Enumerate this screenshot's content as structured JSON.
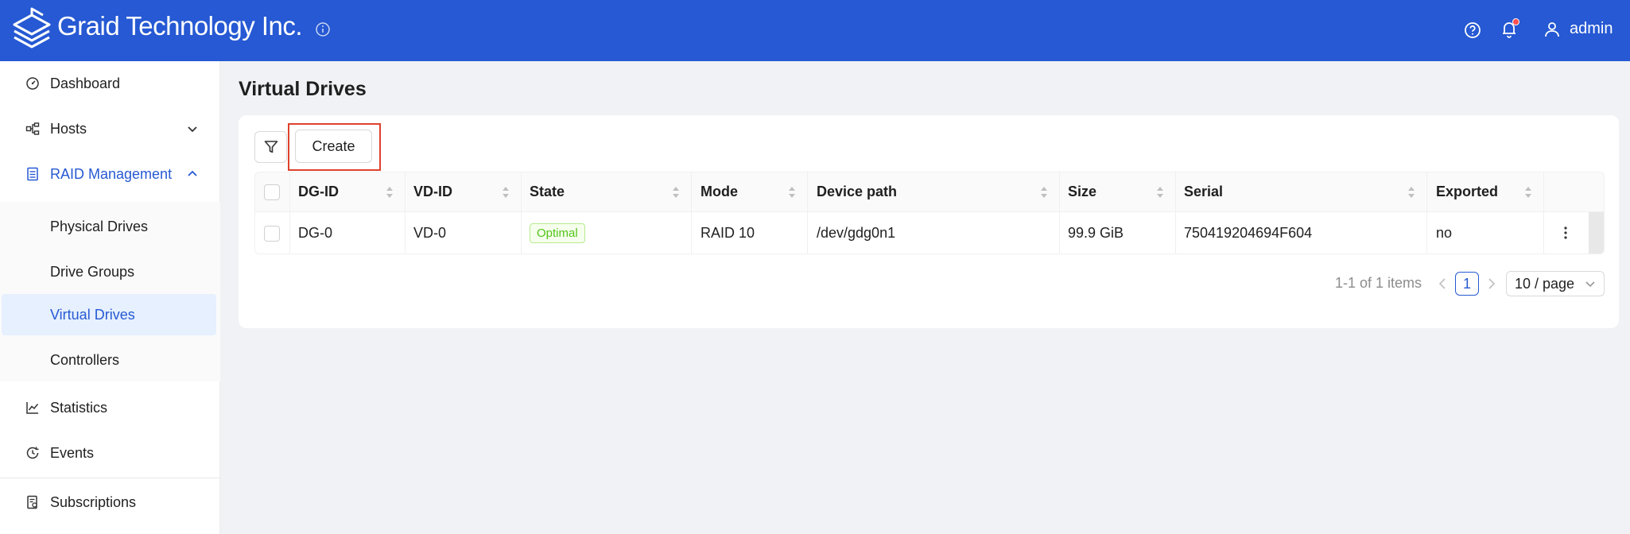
{
  "header": {
    "brand": "Graid Technology Inc.",
    "username": "admin",
    "colors": {
      "bar": "#2659d3",
      "notification_dot": "#ff4d4f"
    },
    "icons": [
      "logo-icon",
      "info-icon",
      "help-icon",
      "bell-icon",
      "user-icon"
    ]
  },
  "sidebar": {
    "items": [
      {
        "label": "Dashboard",
        "icon": "dashboard-icon"
      },
      {
        "label": "Hosts",
        "icon": "hosts-icon",
        "expanded": false
      },
      {
        "label": "RAID Management",
        "icon": "raid-icon",
        "expanded": true
      },
      {
        "label": "Statistics",
        "icon": "statistics-icon"
      },
      {
        "label": "Events",
        "icon": "events-icon"
      },
      {
        "label": "Subscriptions",
        "icon": "subscriptions-icon"
      }
    ],
    "raid_submenu": [
      {
        "label": "Physical Drives"
      },
      {
        "label": "Drive Groups"
      },
      {
        "label": "Virtual Drives",
        "selected": true
      },
      {
        "label": "Controllers"
      }
    ]
  },
  "main": {
    "title": "Virtual Drives",
    "toolbar": {
      "create_label": "Create"
    },
    "table": {
      "columns": [
        "DG-ID",
        "VD-ID",
        "State",
        "Mode",
        "Device path",
        "Size",
        "Serial",
        "Exported"
      ],
      "rows": [
        {
          "dg_id": "DG-0",
          "vd_id": "VD-0",
          "state": "Optimal",
          "mode": "RAID 10",
          "device_path": "/dev/gdg0n1",
          "size": "99.9 GiB",
          "serial": "750419204694F604",
          "exported": "no"
        }
      ]
    },
    "pagination": {
      "total_text": "1-1 of 1 items",
      "current_page": "1",
      "page_size": "10 / page"
    }
  }
}
